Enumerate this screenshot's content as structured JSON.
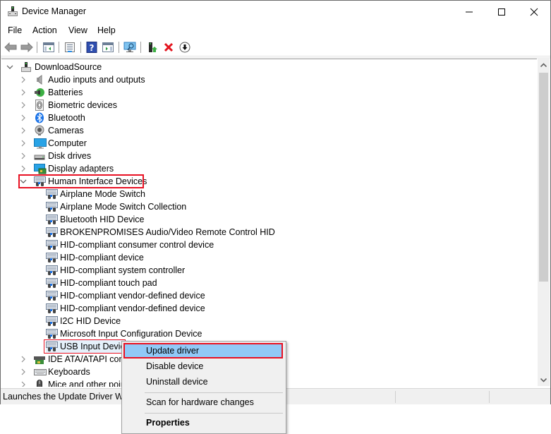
{
  "window": {
    "title": "Device Manager",
    "controls": {
      "minimize": "—",
      "maximize": "☐",
      "close": "✕"
    }
  },
  "menu": [
    "File",
    "Action",
    "View",
    "Help"
  ],
  "toolbar": {
    "buttons": [
      {
        "name": "back",
        "icon": "arrow-left-icon"
      },
      {
        "name": "forward",
        "icon": "arrow-right-icon"
      },
      {
        "name": "show-hide-console-tree",
        "icon": "console-tree-icon"
      },
      {
        "name": "properties",
        "icon": "properties-icon"
      },
      {
        "name": "help",
        "icon": "help-icon",
        "glyph": "?"
      },
      {
        "name": "show-action-pane",
        "icon": "action-pane-icon"
      },
      {
        "name": "scan-hardware",
        "icon": "monitor-scan-icon"
      },
      {
        "name": "update-driver",
        "icon": "update-driver-icon"
      },
      {
        "name": "uninstall-device",
        "icon": "red-x-icon",
        "glyph": "✕"
      },
      {
        "name": "disable-device",
        "icon": "down-arrow-circle-icon",
        "glyph": "⬇"
      }
    ]
  },
  "tree": {
    "root": {
      "label": "DownloadSource",
      "expanded": true,
      "icon": "computer-root-icon"
    },
    "categories_before": [
      {
        "label": "Audio inputs and outputs",
        "icon": "speaker-icon"
      },
      {
        "label": "Batteries",
        "icon": "battery-icon"
      },
      {
        "label": "Biometric devices",
        "icon": "fingerprint-icon"
      },
      {
        "label": "Bluetooth",
        "icon": "bluetooth-icon"
      },
      {
        "label": "Cameras",
        "icon": "camera-icon"
      },
      {
        "label": "Computer",
        "icon": "monitor-icon"
      },
      {
        "label": "Disk drives",
        "icon": "disk-drive-icon"
      },
      {
        "label": "Display adapters",
        "icon": "display-adapter-icon"
      }
    ],
    "expanded_category": {
      "label": "Human Interface Devices",
      "icon": "hid-icon",
      "children": [
        "Airplane Mode Switch",
        "Airplane Mode Switch Collection",
        "Bluetooth HID Device",
        "BROKENPROMISES Audio/Video Remote Control HID",
        "HID-compliant consumer control device",
        "HID-compliant device",
        "HID-compliant system controller",
        "HID-compliant touch pad",
        "HID-compliant vendor-defined device",
        "HID-compliant vendor-defined device",
        "I2C HID Device",
        "Microsoft Input Configuration Device",
        "USB Input Device"
      ],
      "selected_child": "USB Input Device"
    },
    "categories_after": [
      {
        "label": "IDE ATA/ATAPI controllers",
        "visible_label": "IDE ATA/ATAPI contr",
        "icon": "ide-controller-icon"
      },
      {
        "label": "Keyboards",
        "icon": "keyboard-icon"
      },
      {
        "label": "Mice and other pointing devices",
        "visible_label": "Mice and other poin",
        "icon": "mouse-icon"
      }
    ]
  },
  "context_menu": {
    "items": [
      "Update driver",
      "Disable device",
      "Uninstall device",
      "Scan for hardware changes",
      "Properties"
    ],
    "highlighted": "Update driver",
    "bold": "Properties"
  },
  "status_bar": {
    "text": "Launches the Update Driver Wiza"
  },
  "colors": {
    "highlight_box": "#e81123",
    "menu_hover": "#91c9f7"
  }
}
